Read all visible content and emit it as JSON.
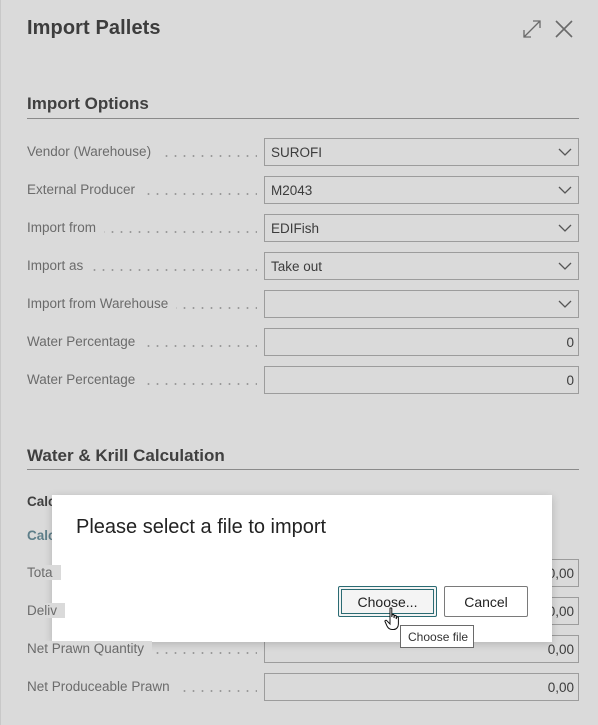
{
  "window": {
    "title": "Import Pallets"
  },
  "import_options": {
    "section_title": "Import Options",
    "fields": [
      {
        "label": "Vendor (Warehouse)",
        "value": "SUROFI",
        "type": "dropdown"
      },
      {
        "label": "External Producer",
        "value": "M2043",
        "type": "dropdown"
      },
      {
        "label": "Import from",
        "value": "EDIFish",
        "type": "dropdown"
      },
      {
        "label": "Import as",
        "value": "Take out",
        "type": "dropdown"
      },
      {
        "label": "Import from Warehouse",
        "value": "",
        "type": "dropdown"
      },
      {
        "label": "Water Percentage",
        "value": "0",
        "type": "number"
      },
      {
        "label": "Water Percentage",
        "value": "0",
        "type": "number"
      }
    ]
  },
  "water_krill": {
    "section_title": "Water & Krill Calculation",
    "partial_labels": [
      "Calc",
      "Calc",
      "Tota",
      "Deliv"
    ],
    "partial_values": [
      "0,00",
      "0,00"
    ],
    "fields": [
      {
        "label": "Net Prawn Quantity",
        "value": "0,00"
      },
      {
        "label": "Net Produceable Prawn",
        "value": "0,00"
      }
    ]
  },
  "dialog": {
    "title": "Please select a file to import",
    "choose_label": "Choose...",
    "cancel_label": "Cancel",
    "tooltip": "Choose file"
  }
}
